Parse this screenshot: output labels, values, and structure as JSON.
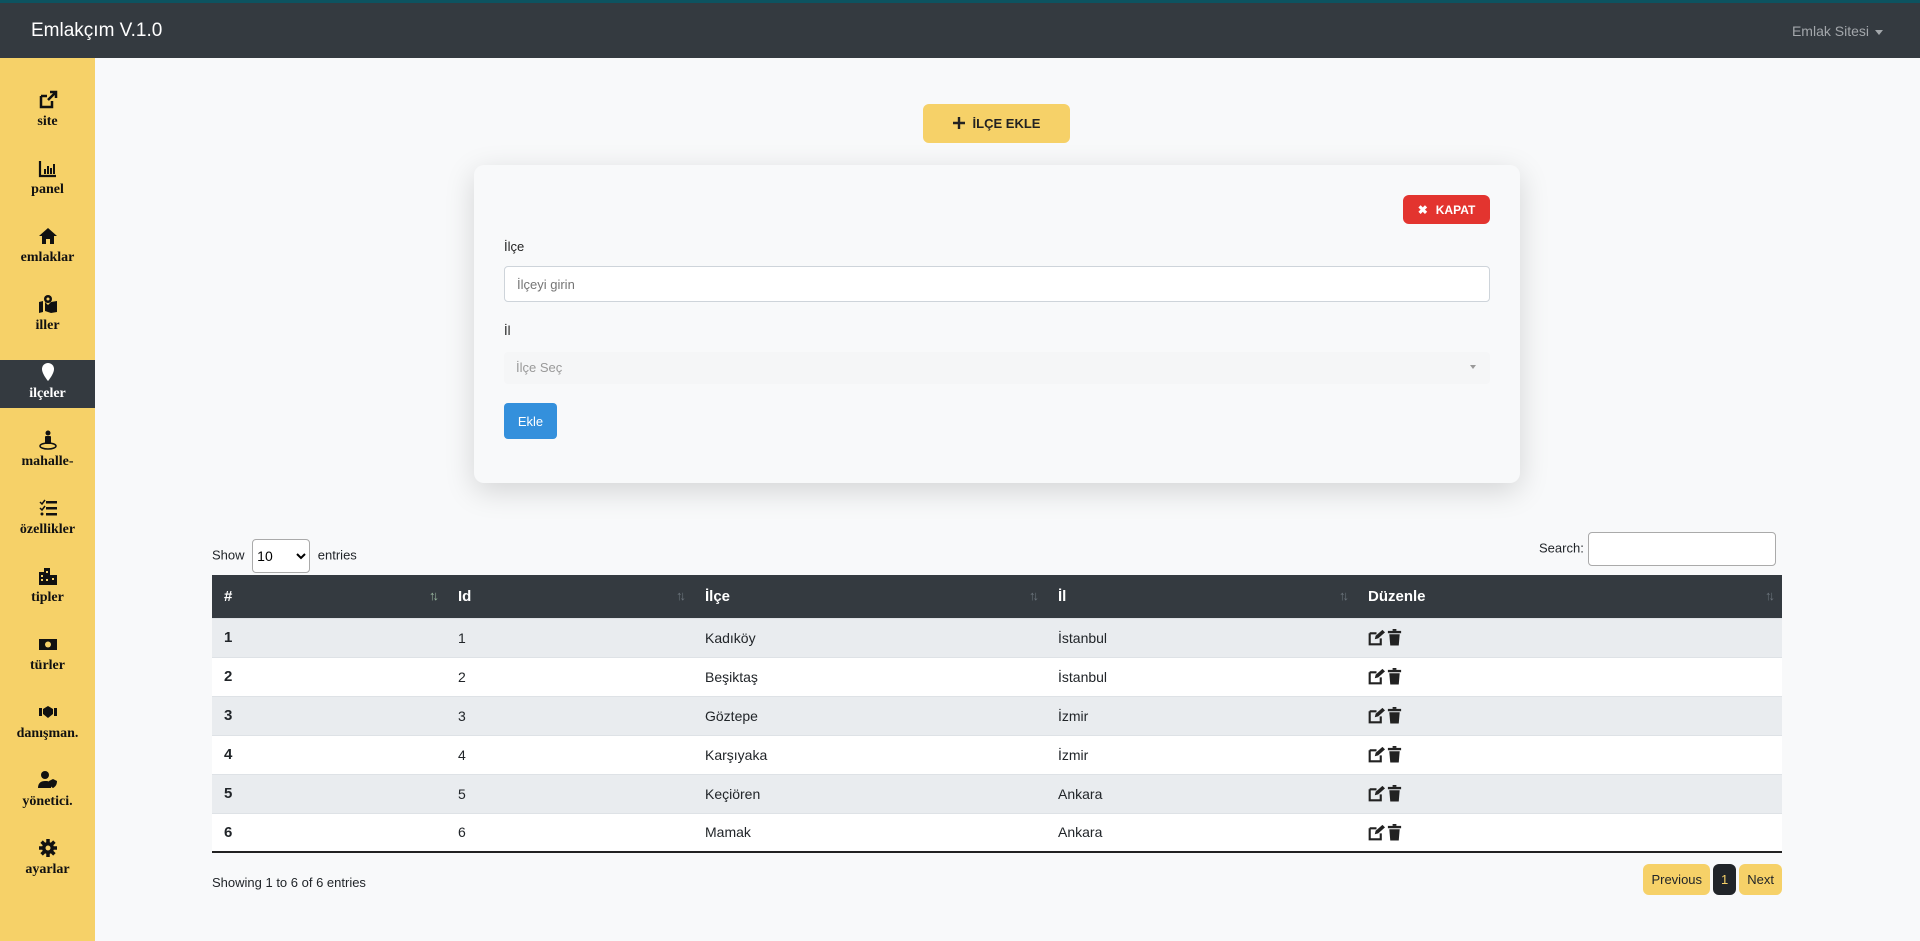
{
  "header": {
    "brand": "Emlakçım V.1.0",
    "user_menu": "Emlak Sitesi"
  },
  "sidebar": {
    "items": [
      {
        "label": "site",
        "icon": "external-link-icon"
      },
      {
        "label": "panel",
        "icon": "chart-bar-icon"
      },
      {
        "label": "emlaklar",
        "icon": "home-icon"
      },
      {
        "label": "iller",
        "icon": "map-marked-icon"
      },
      {
        "label": "ilçeler",
        "icon": "map-marker-icon",
        "active": true
      },
      {
        "label": "mahalle-",
        "icon": "street-view-icon"
      },
      {
        "label": "özellikler",
        "icon": "tasks-icon"
      },
      {
        "label": "tipler",
        "icon": "city-icon"
      },
      {
        "label": "türler",
        "icon": "money-bill-icon"
      },
      {
        "label": "danışman.",
        "icon": "handshake-icon"
      },
      {
        "label": "yönetici.",
        "icon": "user-shield-icon"
      },
      {
        "label": "ayarlar",
        "icon": "cog-icon"
      }
    ]
  },
  "add_button": "İLÇE EKLE",
  "form": {
    "close": "KAPAT",
    "ilce_label": "İlçe",
    "ilce_placeholder": "İlçeyi girin",
    "il_label": "İl",
    "il_select": "İlçe Seç",
    "submit": "Ekle"
  },
  "table_controls": {
    "show": "Show",
    "entries_value": "10",
    "entries": "entries",
    "search": "Search:"
  },
  "table": {
    "headers": [
      "#",
      "Id",
      "İlçe",
      "İl",
      "Düzenle"
    ],
    "rows": [
      [
        "1",
        "1",
        "Kadıköy",
        "İstanbul"
      ],
      [
        "2",
        "2",
        "Beşiktaş",
        "İstanbul"
      ],
      [
        "3",
        "3",
        "Göztepe",
        "İzmir"
      ],
      [
        "4",
        "4",
        "Karşıyaka",
        "İzmir"
      ],
      [
        "5",
        "5",
        "Keçiören",
        "Ankara"
      ],
      [
        "6",
        "6",
        "Mamak",
        "Ankara"
      ]
    ]
  },
  "footer": {
    "info": "Showing 1 to 6 of 6 entries",
    "previous": "Previous",
    "page": "1",
    "next": "Next"
  },
  "colors": {
    "sidebar": "#f6d168",
    "dark": "#343a40",
    "danger": "#e3342f",
    "primary": "#3490dc"
  }
}
